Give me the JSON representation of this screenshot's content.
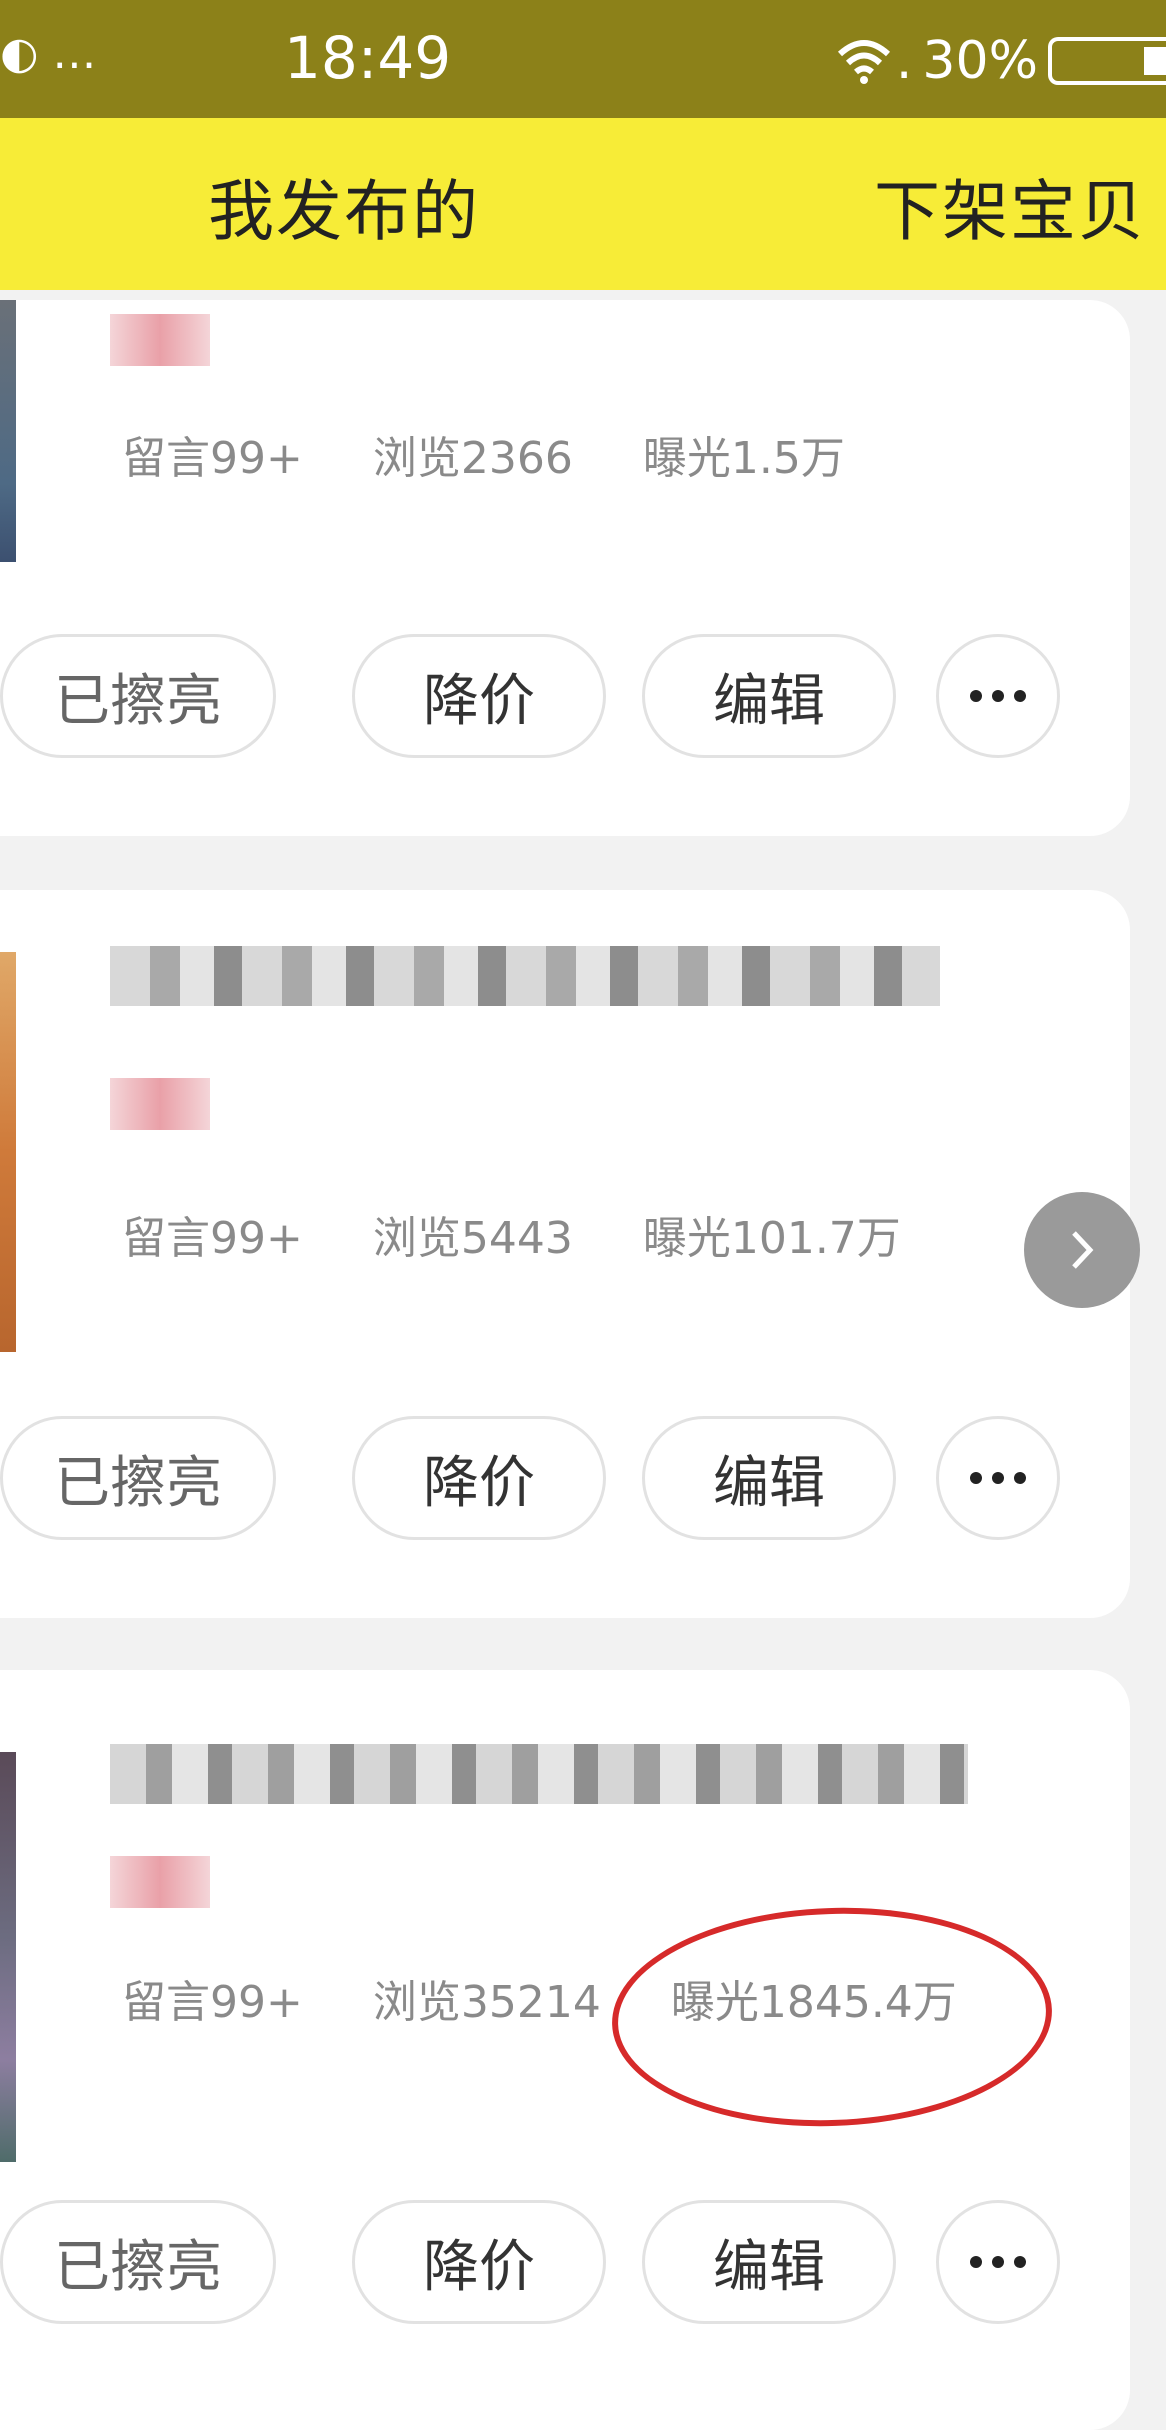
{
  "status_bar": {
    "left_icons": "…",
    "time": "18:49",
    "wifi_suffix": ".",
    "battery_percent": "30%"
  },
  "header": {
    "title": "我发布的",
    "right_action": "下架宝贝"
  },
  "listings": [
    {
      "comments": "留言99+",
      "views": "浏览2366",
      "exposure": "曝光1.5万"
    },
    {
      "comments": "留言99+",
      "views": "浏览5443",
      "exposure": "曝光101.7万"
    },
    {
      "comments": "留言99+",
      "views": "浏览35214",
      "exposure": "曝光1845.4万"
    }
  ],
  "actions": {
    "polished": "已擦亮",
    "reduce_price": "降价",
    "edit": "编辑"
  },
  "colors": {
    "status_bar": "#8c8119",
    "header": "#f7ec37",
    "highlight": "#d62a2a"
  }
}
